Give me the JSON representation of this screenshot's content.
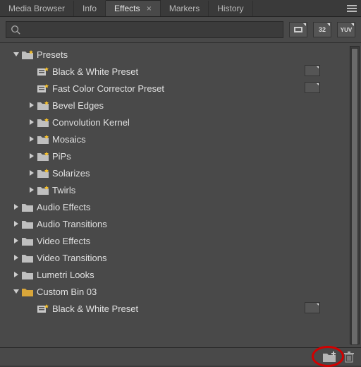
{
  "tabs": {
    "items": [
      {
        "label": "Media Browser"
      },
      {
        "label": "Info"
      },
      {
        "label": "Effects",
        "active": true
      },
      {
        "label": "Markers"
      },
      {
        "label": "History"
      }
    ],
    "close_glyph": "×"
  },
  "search": {
    "placeholder": ""
  },
  "filter_buttons": {
    "accel": "",
    "b32": "32",
    "yuv": "YUV"
  },
  "tree": {
    "presets": {
      "label": "Presets",
      "open": true,
      "items": [
        {
          "type": "preset",
          "label": "Black & White Preset"
        },
        {
          "type": "preset",
          "label": "Fast Color Corrector Preset"
        },
        {
          "type": "folder",
          "label": "Bevel Edges"
        },
        {
          "type": "folder",
          "label": "Convolution Kernel"
        },
        {
          "type": "folder",
          "label": "Mosaics"
        },
        {
          "type": "folder",
          "label": "PiPs"
        },
        {
          "type": "folder",
          "label": "Solarizes"
        },
        {
          "type": "folder",
          "label": "Twirls"
        }
      ]
    },
    "top": [
      {
        "label": "Audio Effects"
      },
      {
        "label": "Audio Transitions"
      },
      {
        "label": "Video Effects"
      },
      {
        "label": "Video Transitions"
      },
      {
        "label": "Lumetri Looks"
      }
    ],
    "custom": {
      "label": "Custom Bin 03",
      "items": [
        {
          "type": "preset",
          "label": "Black & White Preset"
        }
      ]
    }
  }
}
